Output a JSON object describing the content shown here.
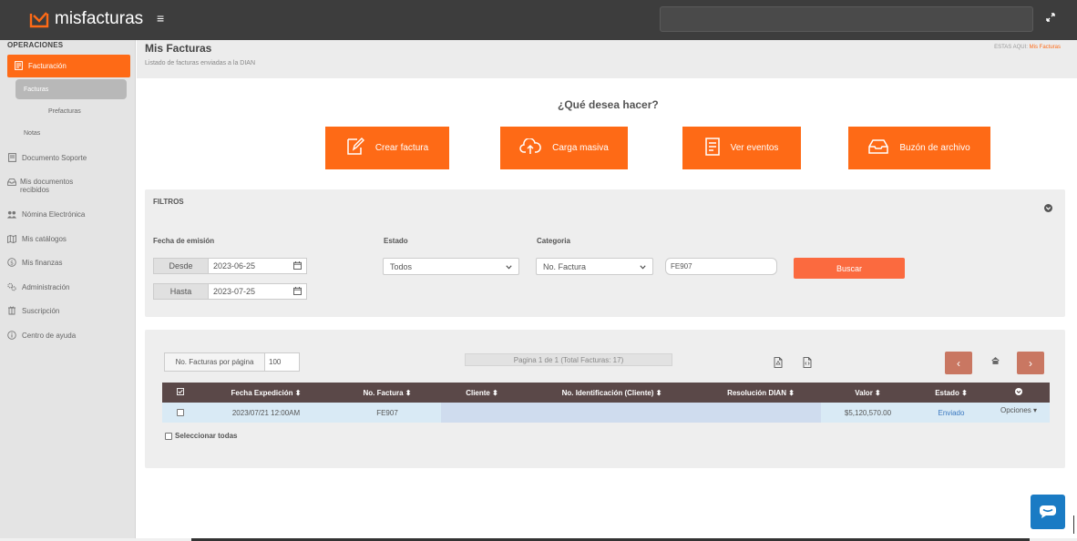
{
  "colors": {
    "accent": "#fe6a16",
    "topbar": "#3d3d3d",
    "table_header": "#5a4848",
    "pager": "#c97762",
    "chat": "#1a7bc4"
  },
  "brand": {
    "name": "misfacturas",
    "logo_icon": "check-chart-icon"
  },
  "sidebar": {
    "section": "OPERACIONES",
    "active": {
      "label": "Facturación",
      "icon": "document-icon"
    },
    "sub_active": "Facturas",
    "sub_items": [
      "Prefacturas",
      "Notas"
    ],
    "items": [
      {
        "label": "Documento Soporte",
        "icon": "document-icon"
      },
      {
        "label": "Mis documentos recibidos",
        "icon": "inbox-icon"
      },
      {
        "label": "Nómina Electrónica",
        "icon": "people-icon"
      },
      {
        "label": "Mis catálogos",
        "icon": "map-icon"
      },
      {
        "label": "Mis finanzas",
        "icon": "coin-icon"
      },
      {
        "label": "Administración",
        "icon": "gears-icon"
      },
      {
        "label": "Suscripción",
        "icon": "package-icon"
      },
      {
        "label": "Centro de ayuda",
        "icon": "info-icon"
      }
    ]
  },
  "header": {
    "title": "Mis Facturas",
    "subtitle": "Listado de facturas enviadas a la DIAN",
    "breadcrumb_prefix": "ESTAS AQUI:",
    "breadcrumb_current": "Mis Facturas"
  },
  "actions": {
    "question": "¿Qué desea hacer?",
    "buttons": [
      {
        "label": "Crear factura",
        "icon": "edit-document-icon"
      },
      {
        "label": "Carga masiva",
        "icon": "cloud-upload-icon"
      },
      {
        "label": "Ver eventos",
        "icon": "list-document-icon"
      },
      {
        "label": "Buzón de archivo",
        "icon": "inbox-icon"
      }
    ]
  },
  "filters": {
    "title": "FILTROS",
    "date_label": "Fecha de emisión",
    "from_label": "Desde",
    "from_value": "2023-06-25",
    "to_label": "Hasta",
    "to_value": "2023-07-25",
    "status_label": "Estado",
    "status_value": "Todos",
    "category_label": "Categoria",
    "category_value": "No. Factura",
    "search_value": "FE907",
    "search_button": "Buscar"
  },
  "results": {
    "per_page_label": "No. Facturas por página",
    "per_page_value": "100",
    "page_info": "Pagina 1 de 1 (Total Facturas: 17)",
    "prev": "‹",
    "next": "›",
    "select_all": "Seleccionar todas",
    "columns": [
      "Fecha Expedición",
      "No. Factura",
      "Cliente",
      "No. Identificación (Cliente)",
      "Resolución DIAN",
      "Valor",
      "Estado"
    ],
    "sort_glyph": "⬍",
    "rows": [
      {
        "fecha": "2023/07/21 12:00AM",
        "factura": "FE907",
        "cliente": "",
        "identificacion": "",
        "resolucion": "",
        "valor": "$5,120,570.00",
        "estado": "Enviado",
        "opciones": "Opciones ▾"
      }
    ]
  }
}
